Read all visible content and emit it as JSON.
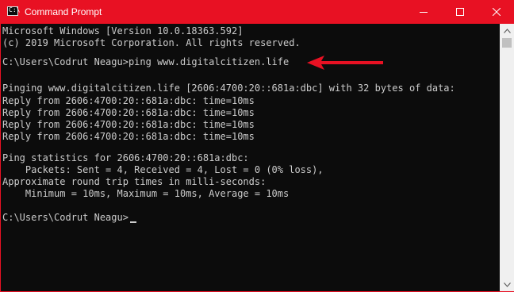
{
  "window": {
    "title": "Command Prompt",
    "icon": "terminal-icon",
    "icon_glyph": "C:\\",
    "accent_color": "#e81123",
    "controls": {
      "minimize": "minimize-icon",
      "maximize": "maximize-icon",
      "close": "close-icon"
    }
  },
  "console": {
    "lines": [
      "Microsoft Windows [Version 10.0.18363.592]",
      "(c) 2019 Microsoft Corporation. All rights reserved.",
      "",
      "C:\\Users\\Codrut Neagu>ping www.digitalcitizen.life",
      "",
      "Pinging www.digitalcitizen.life [2606:4700:20::681a:dbc] with 32 bytes of data:",
      "Reply from 2606:4700:20::681a:dbc: time=10ms",
      "Reply from 2606:4700:20::681a:dbc: time=10ms",
      "Reply from 2606:4700:20::681a:dbc: time=10ms",
      "Reply from 2606:4700:20::681a:dbc: time=10ms",
      "",
      "Ping statistics for 2606:4700:20::681a:dbc:",
      "    Packets: Sent = 4, Received = 4, Lost = 0 (0% loss),",
      "Approximate round trip times in milli-seconds:",
      "    Minimum = 10ms, Maximum = 10ms, Average = 10ms",
      "",
      "C:\\Users\\Codrut Neagu>"
    ],
    "text_color": "#cccccc",
    "background_color": "#0c0c0c"
  },
  "annotation": {
    "icon": "arrow-left-icon",
    "color": "#e81123"
  },
  "scrollbar": {
    "up": "chevron-up-icon",
    "down": "chevron-down-icon"
  }
}
